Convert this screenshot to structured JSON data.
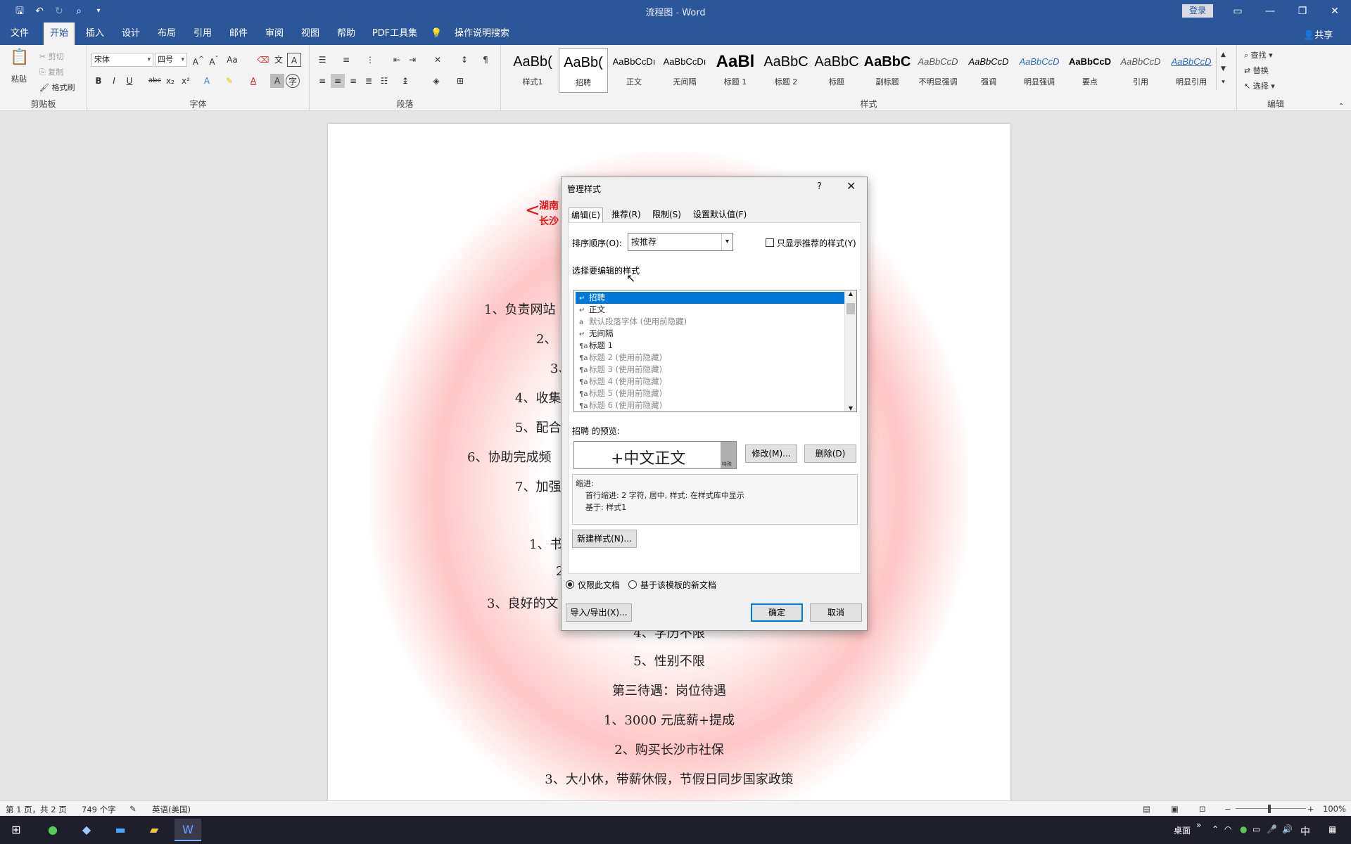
{
  "app": {
    "title": "流程图 - Word",
    "login": "登录",
    "share": "共享"
  },
  "menu_tabs": [
    "文件",
    "开始",
    "插入",
    "设计",
    "布局",
    "引用",
    "邮件",
    "审阅",
    "视图",
    "帮助",
    "PDF工具集",
    "操作说明搜索"
  ],
  "active_tab": "开始",
  "ribbon": {
    "clipboard": {
      "paste": "粘贴",
      "cut": "剪切",
      "copy": "复制",
      "format_painter": "格式刷",
      "label": "剪贴板"
    },
    "font": {
      "font_name": "宋体",
      "font_size": "四号",
      "label": "字体"
    },
    "paragraph": {
      "label": "段落"
    },
    "styles": {
      "label": "样式",
      "items": [
        {
          "sample": "AaBb(",
          "name": "样式1"
        },
        {
          "sample": "AaBb(",
          "name": "招聘"
        },
        {
          "sample": "AaBbCcDı",
          "name": "正文"
        },
        {
          "sample": "AaBbCcDı",
          "name": "无间隔"
        },
        {
          "sample": "AaBl",
          "name": "标题 1"
        },
        {
          "sample": "AaBbC",
          "name": "标题 2"
        },
        {
          "sample": "AaBbC",
          "name": "标题"
        },
        {
          "sample": "AaBbC",
          "name": "副标题"
        },
        {
          "sample": "AaBbCcD",
          "name": "不明显强调"
        },
        {
          "sample": "AaBbCcD",
          "name": "强调"
        },
        {
          "sample": "AaBbCcD",
          "name": "明显强调"
        },
        {
          "sample": "AaBbCcD",
          "name": "要点"
        },
        {
          "sample": "AaBbCcD",
          "name": "引用"
        },
        {
          "sample": "AaBbCcD",
          "name": "明显引用"
        }
      ]
    },
    "editing": {
      "find": "查找",
      "replace": "替换",
      "select": "选择",
      "label": "编辑"
    }
  },
  "document": {
    "stamp_line1": "湖南",
    "stamp_line2": "长沙",
    "lines": [
      "1、负责网站",
      "2、",
      "3、",
      "4、收集",
      "5、配合",
      "6、协助完成频",
      "7、加强",
      "1、书",
      "2",
      "3、良好的文",
      "4、学历不限",
      "5、性别不限",
      "第三待遇：岗位待遇",
      "1、3000 元底薪+提成",
      "2、购买长沙市社保",
      "3、大小休，带薪休假，节假日同步国家政策"
    ]
  },
  "dialog": {
    "title": "管理样式",
    "help": "?",
    "tabs": [
      "编辑(E)",
      "推荐(R)",
      "限制(S)",
      "设置默认值(F)"
    ],
    "sort_label": "排序顺序(O):",
    "sort_value": "按推荐",
    "only_recommended": "只显示推荐的样式(Y)",
    "select_label": "选择要编辑的样式",
    "styles_list": [
      {
        "glyph": "↵",
        "name": "招聘",
        "note": ""
      },
      {
        "glyph": "↵",
        "name": "正文",
        "note": ""
      },
      {
        "glyph": "a",
        "name": "默认段落字体",
        "note": "(使用前隐藏)"
      },
      {
        "glyph": "↵",
        "name": "无间隔",
        "note": ""
      },
      {
        "glyph": "¶a",
        "name": "标题 1",
        "note": ""
      },
      {
        "glyph": "¶a",
        "name": "标题 2",
        "note": "(使用前隐藏)"
      },
      {
        "glyph": "¶a",
        "name": "标题 3",
        "note": "(使用前隐藏)"
      },
      {
        "glyph": "¶a",
        "name": "标题 4",
        "note": "(使用前隐藏)"
      },
      {
        "glyph": "¶a",
        "name": "标题 5",
        "note": "(使用前隐藏)"
      },
      {
        "glyph": "¶a",
        "name": "标题 6",
        "note": "(使用前隐藏)"
      }
    ],
    "preview_label": "招聘 的预览:",
    "preview_text": "+中文正文",
    "preview_badge": "特殊",
    "modify": "修改(M)...",
    "delete": "删除(D)",
    "desc_line1": "缩进:",
    "desc_line2": "首行缩进: 2 字符, 居中, 样式: 在样式库中显示",
    "desc_line3": "基于: 样式1",
    "new_style": "新建样式(N)...",
    "radio_this_doc": "仅限此文档",
    "radio_template": "基于该模板的新文档",
    "import_export": "导入/导出(X)...",
    "ok": "确定",
    "cancel": "取消"
  },
  "status": {
    "page": "第 1 页，共 2 页",
    "words": "749 个字",
    "lang": "英语(美国)",
    "zoom": "100%"
  },
  "taskbar": {
    "desktop": "桌面",
    "ime": "中"
  }
}
